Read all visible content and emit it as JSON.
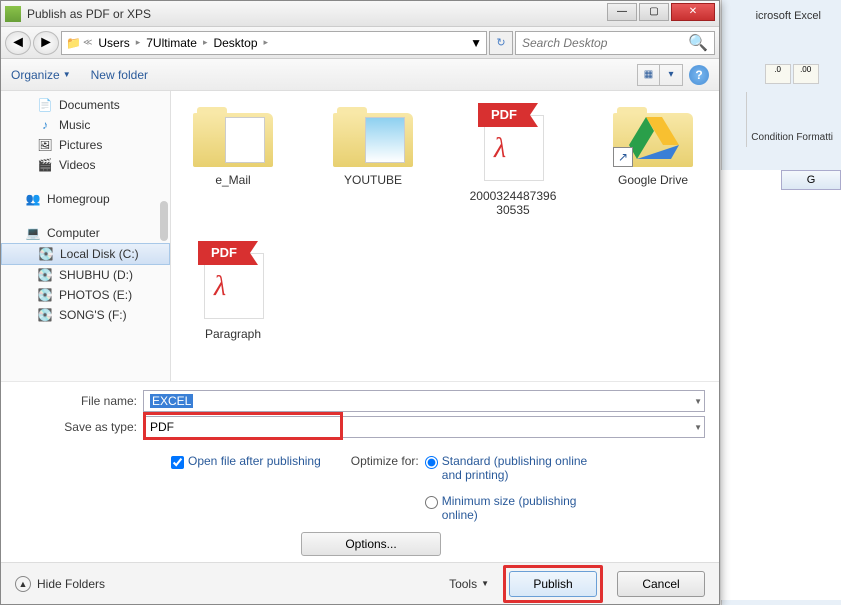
{
  "excel": {
    "title": "icrosoft Excel",
    "cond_format": "Condition Formatti",
    "col_g": "G"
  },
  "dialog": {
    "title": "Publish as PDF or XPS"
  },
  "path": {
    "seg1": "Users",
    "seg2": "7Ultimate",
    "seg3": "Desktop"
  },
  "search": {
    "placeholder": "Search Desktop"
  },
  "toolbar": {
    "organize": "Organize",
    "new_folder": "New folder"
  },
  "sidebar": {
    "documents": "Documents",
    "music": "Music",
    "pictures": "Pictures",
    "videos": "Videos",
    "homegroup": "Homegroup",
    "computer": "Computer",
    "localc": "Local Disk (C:)",
    "shubhu": "SHUBHU (D:)",
    "photos": "PHOTOS (E:)",
    "songs": "SONG'S (F:)"
  },
  "files": {
    "email": "e_Mail",
    "youtube": "YOUTUBE",
    "longnum": "2000324487396\n30535",
    "gdrive": "Google Drive",
    "paragraph": "Paragraph",
    "pdf_badge": "PDF"
  },
  "form": {
    "filename_label": "File name:",
    "filename_value": "EXCEL",
    "savetype_label": "Save as type:",
    "savetype_value": "PDF",
    "open_after": "Open file after publishing",
    "optimize_label": "Optimize for:",
    "opt_standard": "Standard (publishing online and printing)",
    "opt_min": "Minimum size (publishing online)",
    "options_btn": "Options..."
  },
  "footer": {
    "hide": "Hide Folders",
    "tools": "Tools",
    "publish": "Publish",
    "cancel": "Cancel"
  }
}
